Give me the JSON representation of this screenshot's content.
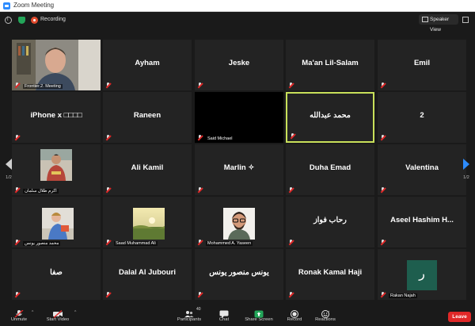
{
  "window": {
    "title": "Zoom Meeting"
  },
  "topbar": {
    "recording_label": "Recording",
    "speaker_view_label": "Speaker View"
  },
  "tiles": [
    {
      "name": "",
      "tag": "Frontier.2. Meeting",
      "kind": "video-man"
    },
    {
      "name": "Ayham",
      "tag": ""
    },
    {
      "name": "Jeske",
      "tag": ""
    },
    {
      "name": "Ma'an Lil-Salam",
      "tag": ""
    },
    {
      "name": "Emil",
      "tag": ""
    },
    {
      "name": "iPhone x □□□□",
      "tag": ""
    },
    {
      "name": "Raneen",
      "tag": ""
    },
    {
      "name": "",
      "tag": "Said Michael",
      "kind": "black"
    },
    {
      "name": "محمد عبدالله",
      "tag": "",
      "active": true
    },
    {
      "name": "2",
      "tag": ""
    },
    {
      "name": "",
      "tag": "اكرم طلال سلمان",
      "kind": "photo-man-sweater"
    },
    {
      "name": "Ali Kamil",
      "tag": ""
    },
    {
      "name": "Marlin ✧",
      "tag": ""
    },
    {
      "name": "Duha Emad",
      "tag": ""
    },
    {
      "name": "Valentina",
      "tag": ""
    },
    {
      "name": "",
      "tag": "محمد منصور يونس",
      "kind": "photo-kid"
    },
    {
      "name": "",
      "tag": "Saad Muhammad Ali",
      "kind": "photo-landscape"
    },
    {
      "name": "",
      "tag": "Mohammed A. Yaseen",
      "kind": "photo-glasses"
    },
    {
      "name": "رحاب فواز",
      "tag": ""
    },
    {
      "name": "Aseel  Hashim  H...",
      "tag": ""
    },
    {
      "name": "صفا",
      "tag": ""
    },
    {
      "name": "Dalal Al Jubouri",
      "tag": ""
    },
    {
      "name": "يونس منصور يونس",
      "tag": ""
    },
    {
      "name": "Ronak Kamal Haji",
      "tag": ""
    },
    {
      "name": "",
      "tag": "Rakan Najah",
      "kind": "avatar",
      "avatar_letter": "ر"
    }
  ],
  "pager": {
    "left": "1/2",
    "right": "1/2"
  },
  "toolbar": {
    "unmute": "Unmute",
    "start_video": "Start Video",
    "participants": "Participants",
    "participants_count": "40",
    "chat": "Chat",
    "share_screen": "Share Screen",
    "record": "Record",
    "reactions": "Reactions",
    "leave": "Leave"
  },
  "colors": {
    "accent": "#2d8cff",
    "active_border": "#c8e05a",
    "leave": "#e02828",
    "share": "#23a559",
    "avatar": "#1e5e4e"
  }
}
